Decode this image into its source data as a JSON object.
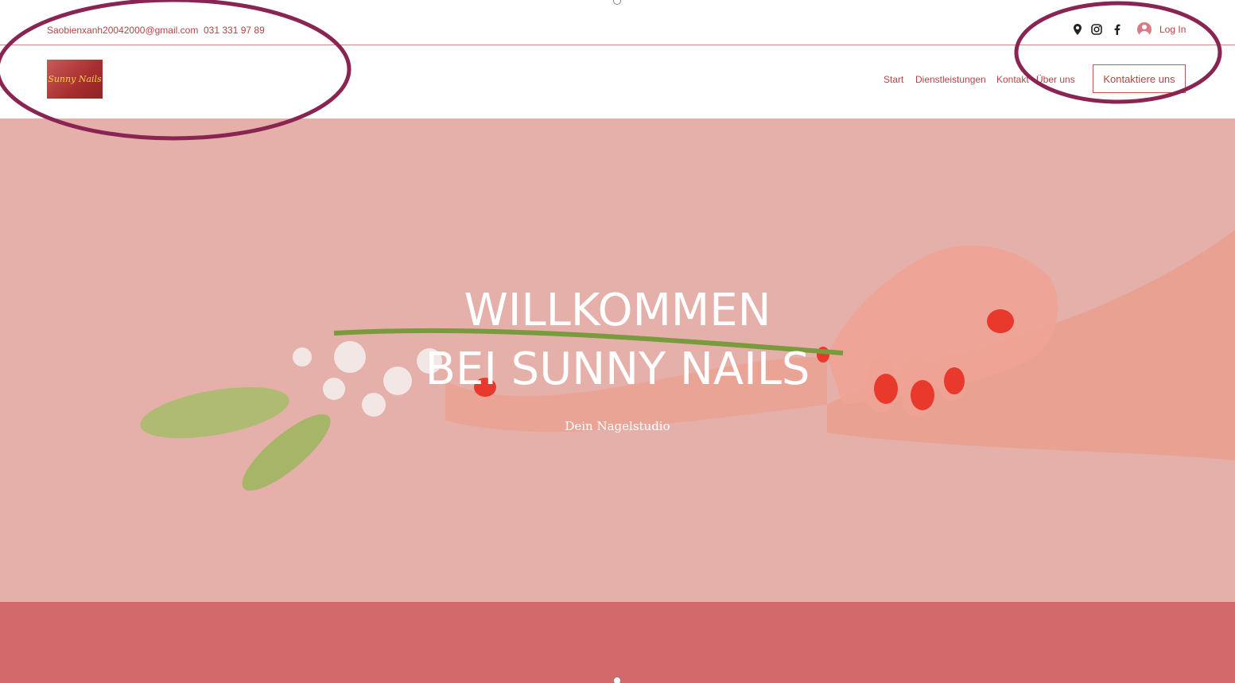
{
  "topbar": {
    "email": "Saobienxanh20042000@gmail.com",
    "phone": "031 331 97 89",
    "social_icons": [
      "location-pin-icon",
      "instagram-icon",
      "facebook-icon"
    ],
    "login_label": "Log In"
  },
  "header": {
    "logo_text": "Sunny Nails",
    "nav": [
      "Start",
      "Dienstleistungen",
      "Kontakt",
      "Über uns"
    ],
    "cta_label": "Kontaktiere uns"
  },
  "hero": {
    "title_line1": "WILLKOMMEN",
    "title_line2": "BEI SUNNY NAILS",
    "subtitle": "Dein Nagelstudio"
  },
  "colors": {
    "accent_text": "#b14545",
    "hero_bg": "#e4b0a9",
    "strip_bg": "#d4696b",
    "annotation": "#8a2452"
  }
}
